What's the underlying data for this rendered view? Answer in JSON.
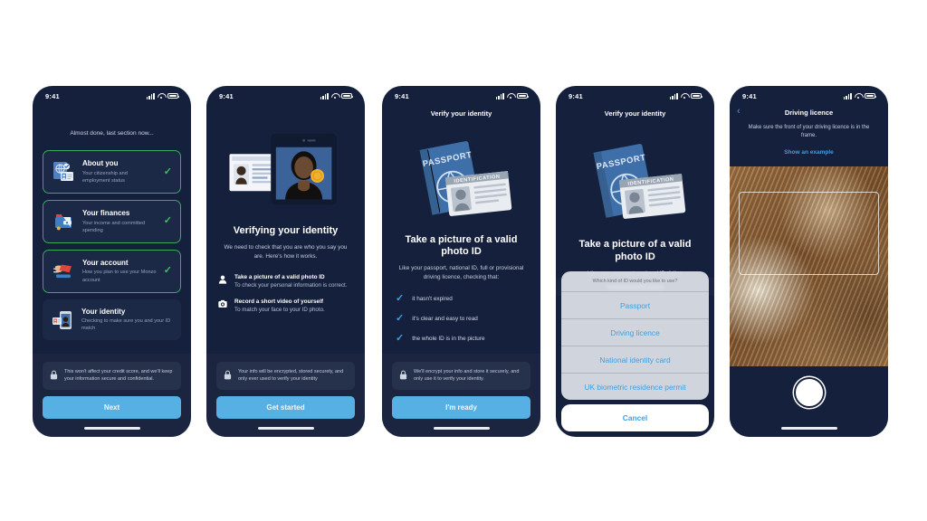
{
  "meta": {
    "status_time": "9:41",
    "accent_blue": "#57b0e3",
    "link_blue": "#3f9fe0",
    "screen_bg": "#15203c",
    "card_bg": "#1c2946",
    "success_green": "#3fbe63"
  },
  "screen1": {
    "heading": "Almost done, last section now...",
    "cards": [
      {
        "title": "About you",
        "subtitle": "Your citizenship and employment status",
        "icon": "passport-globe-icon",
        "done": true
      },
      {
        "title": "Your finances",
        "subtitle": "Your income and committed spending",
        "icon": "wallet-icon",
        "done": true
      },
      {
        "title": "Your account",
        "subtitle": "How you plan to use your Monzo account",
        "icon": "hand-card-icon",
        "done": true
      },
      {
        "title": "Your identity",
        "subtitle": "Checking to make sure you and your ID match",
        "icon": "phone-id-icon",
        "done": false
      }
    ],
    "notice": "This won't affect your credit score, and we'll keep your information secure and confidential.",
    "button": "Next"
  },
  "screen2": {
    "heading": "Verifying your identity",
    "subheading": "We need to check that you are who you say you are. Here's how it works.",
    "bullets": [
      {
        "icon": "person-icon",
        "title": "Take a picture of a valid photo ID",
        "subtitle": "To check your personal information is correct."
      },
      {
        "icon": "camera-icon",
        "title": "Record a short video of yourself",
        "subtitle": "To match your face to your ID photo."
      }
    ],
    "notice": "Your info will be encrypted, stored securely, and only ever used to verify your identity",
    "button": "Get started"
  },
  "screen3": {
    "navtitle": "Verify your identity",
    "heading": "Take a picture of a valid photo ID",
    "subheading": "Like your passport, national ID, full or provisional driving licence, checking that:",
    "checks": [
      "it hasn't expired",
      "it's clear and easy to read",
      "the whole ID is in the picture"
    ],
    "notice": "We'll encrypt your info and store it securely, and only use it to verify your identity.",
    "button": "I'm ready"
  },
  "screen4": {
    "navtitle": "Verify your identity",
    "heading": "Take a picture of a valid photo ID",
    "subheading": "Like your passport, national ID, full or",
    "sheet": {
      "title": "Which kind of ID would you like to use?",
      "options": [
        "Passport",
        "Driving licence",
        "National identity card",
        "UK biometric residence permit"
      ],
      "cancel": "Cancel"
    }
  },
  "screen5": {
    "back": "‹",
    "title": "Driving licence",
    "instruction": "Make sure the front of your driving licence is in the frame.",
    "link": "Show an example",
    "shutter_label": "Take photo"
  }
}
